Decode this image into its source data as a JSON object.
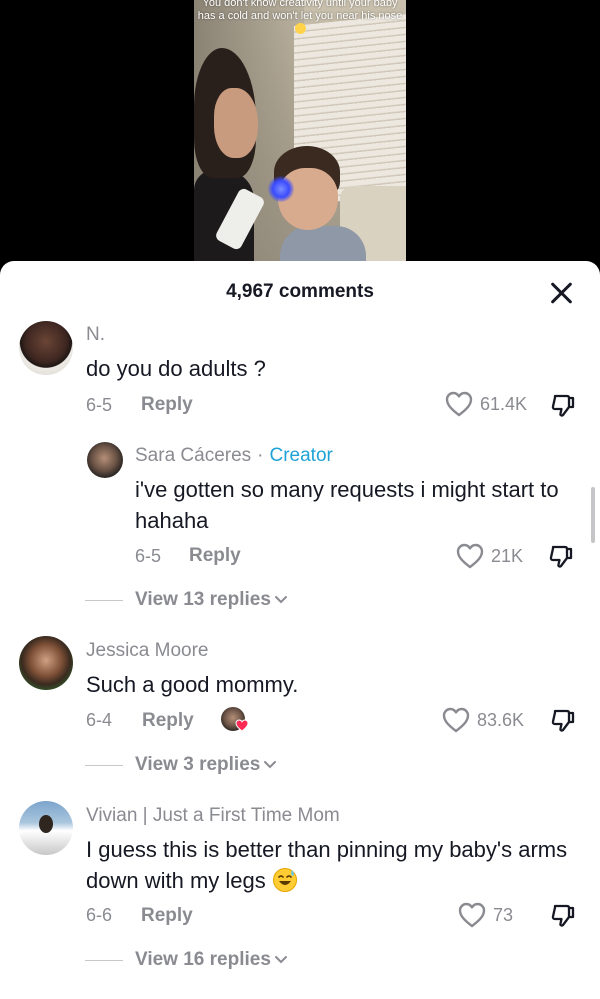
{
  "video": {
    "caption": "You don't know creativity until your baby has a cold and won't let you near his nose",
    "caption_emoji": "sweat-smile-emoji"
  },
  "sheet": {
    "comment_count": "4,967 comments",
    "close_icon": "close-icon"
  },
  "comments": [
    {
      "username": "N.",
      "text": "do you do adults ?",
      "date": "6-5",
      "reply_label": "Reply",
      "likes": "61.4K",
      "replies": [
        {
          "username": "Sara Cáceres",
          "separator": "·",
          "badge": "Creator",
          "text": "i've gotten so many requests i might start to hahaha",
          "date": "6-5",
          "reply_label": "Reply",
          "likes": "21K"
        }
      ],
      "view_replies": "View 13 replies"
    },
    {
      "username": "Jessica Moore",
      "text": "Such a good mommy.",
      "date": "6-4",
      "reply_label": "Reply",
      "likes": "83.6K",
      "liked_by_creator": true,
      "view_replies": "View 3 replies"
    },
    {
      "username": "Vivian | Just a First Time Mom",
      "text": "I guess this is better than pinning my baby's arms down with my legs",
      "text_emoji": "sweat-smile-emoji",
      "date": "6-6",
      "reply_label": "Reply",
      "likes": "73",
      "view_replies": "View 16 replies"
    }
  ],
  "colors": {
    "text_primary": "#161823",
    "text_secondary": "#8a8b91",
    "creator_badge": "#1fa3d6",
    "liked_heart": "#fe2c55"
  }
}
